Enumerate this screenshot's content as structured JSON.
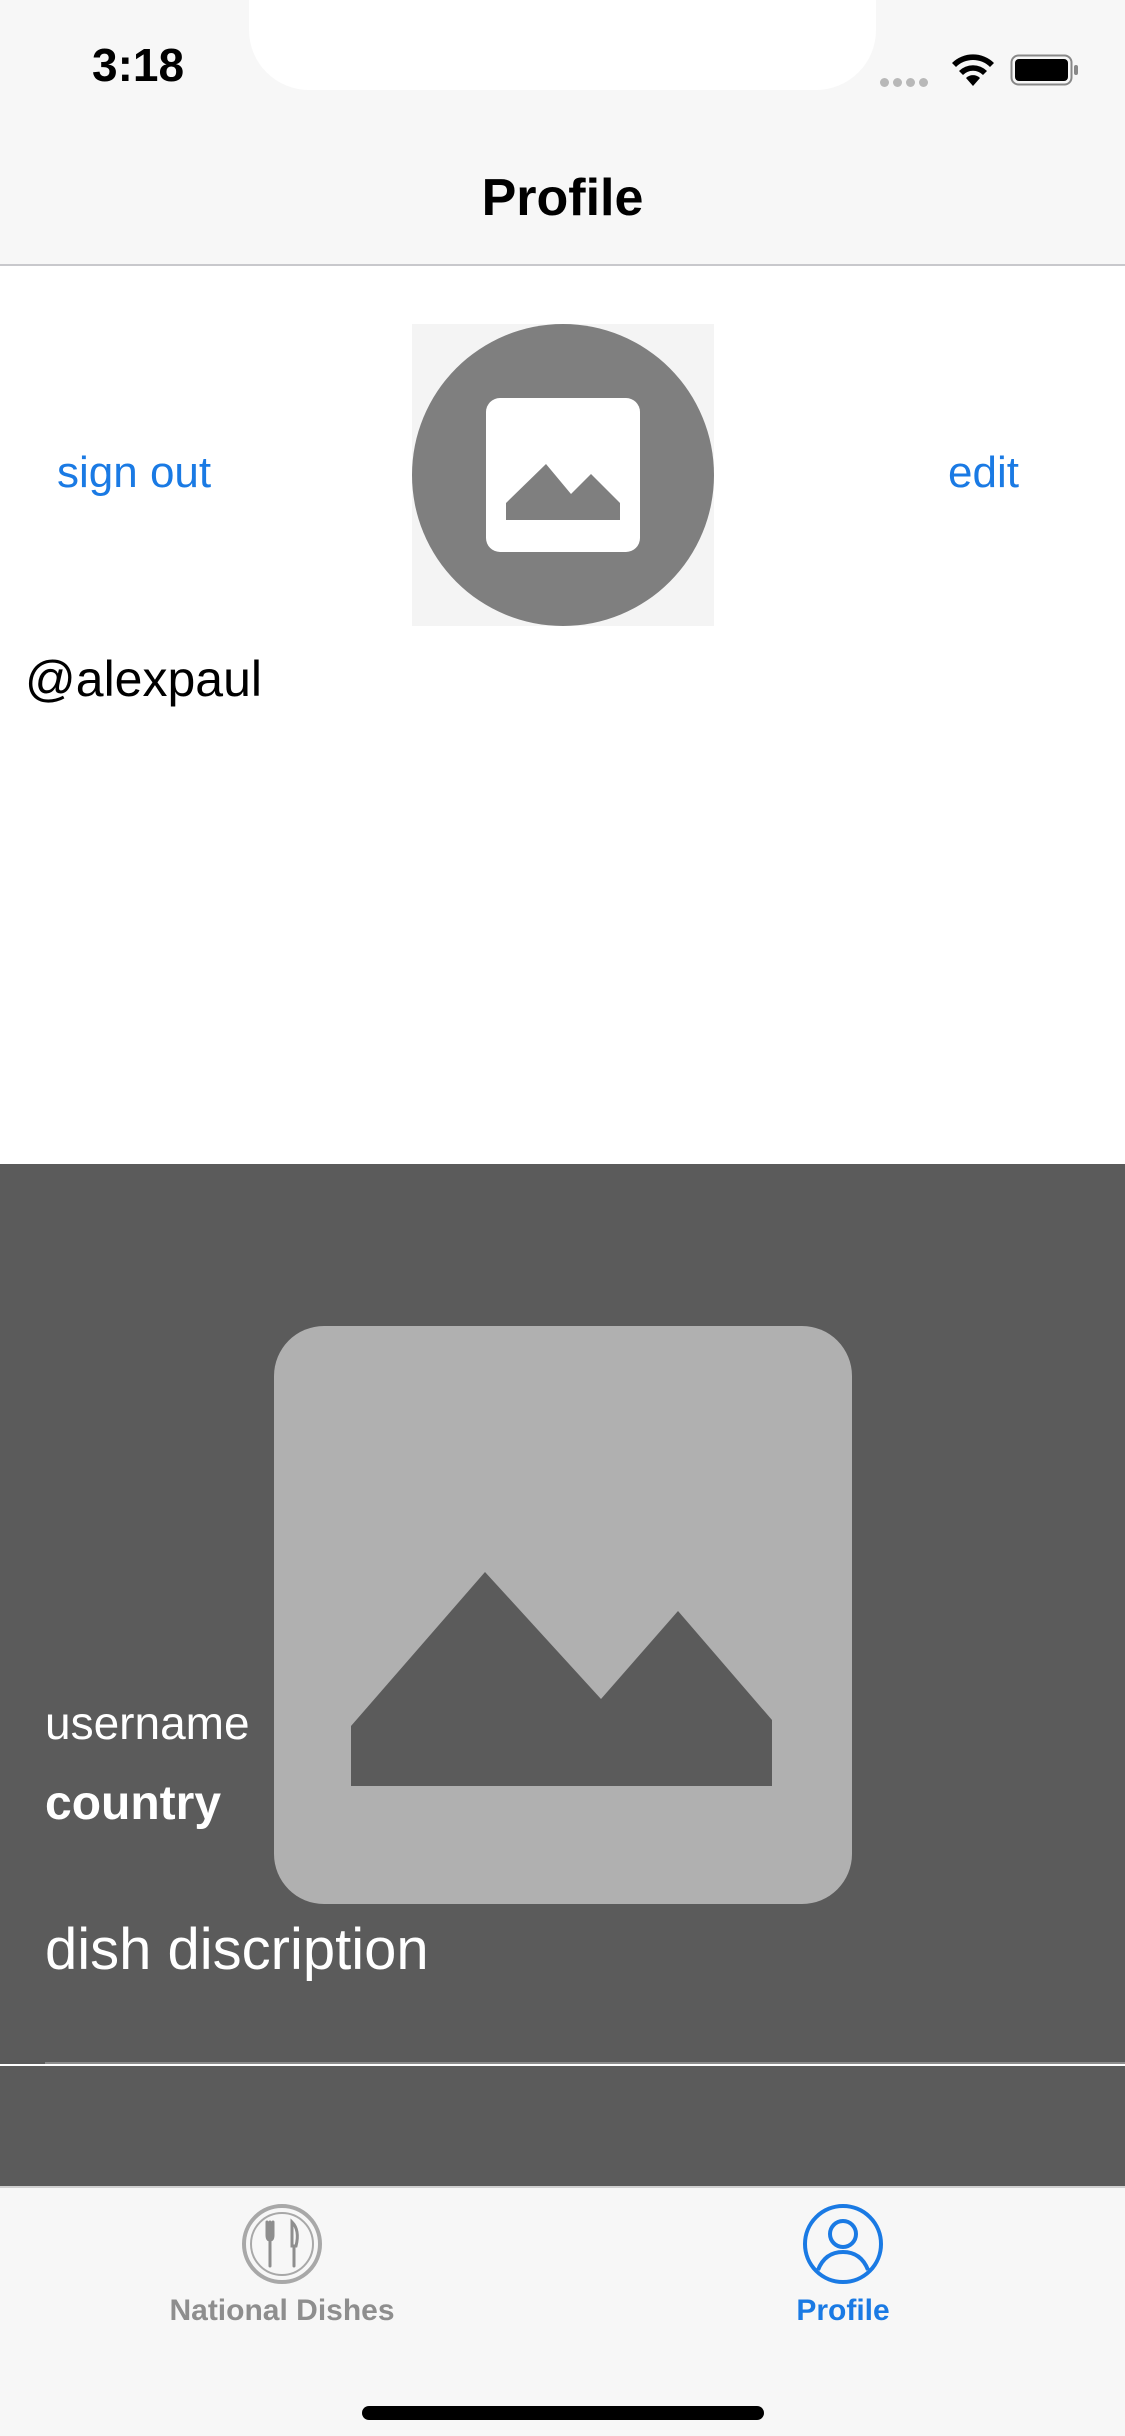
{
  "status_bar": {
    "time": "3:18",
    "icons": [
      "signal-dots-icon",
      "wifi-icon",
      "battery-icon"
    ]
  },
  "nav": {
    "title": "Profile"
  },
  "profile": {
    "sign_out_label": "sign out",
    "edit_label": "edit",
    "avatar_icon": "photo-placeholder-icon",
    "handle": "@alexpaul"
  },
  "dish_cell": {
    "photo_icon": "photo-placeholder-icon",
    "username": "username",
    "country": "country",
    "description": "dish discription"
  },
  "tab_bar": {
    "items": [
      {
        "label": "National Dishes",
        "icon": "fork-knife-icon",
        "selected": false
      },
      {
        "label": "Profile",
        "icon": "person-circle-icon",
        "selected": true
      }
    ]
  },
  "colors": {
    "accent": "#1a7ae4",
    "inactive_tab": "#8e8e8e",
    "cell_background": "#5b5b5b",
    "placeholder_gray": "#7f7f7f",
    "placeholder_light": "#b0b0b0"
  }
}
